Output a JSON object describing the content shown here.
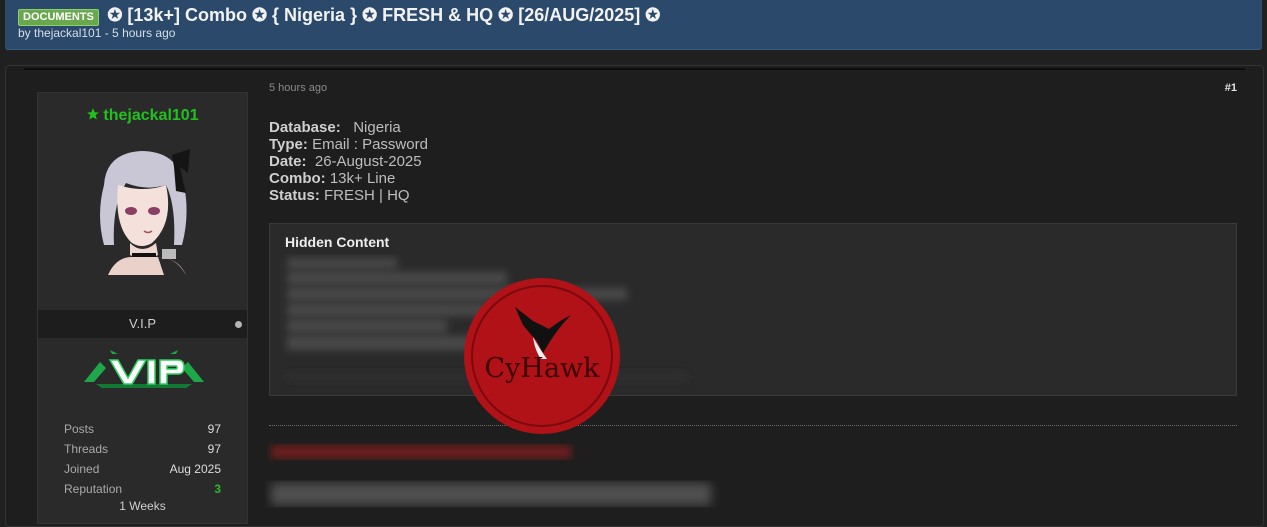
{
  "thread": {
    "prefix": "DOCUMENTS",
    "title": "✪ [13k+] Combo ✪ { Nigeria } ✪ FRESH & HQ ✪ [26/AUG/2025] ✪",
    "meta": "by thejackal101 - 5 hours ago"
  },
  "author": {
    "username": "thejackal101",
    "rank": "V.I.P",
    "badge_icon": "vip-logo",
    "stats": [
      {
        "label": "Posts",
        "value": "97"
      },
      {
        "label": "Threads",
        "value": "97"
      },
      {
        "label": "Joined",
        "value": "Aug 2025"
      },
      {
        "label": "Reputation",
        "value": "3"
      }
    ],
    "activity": "1 Weeks"
  },
  "post": {
    "date": "5 hours ago",
    "number": "#1",
    "fields": [
      {
        "label": "Database:",
        "value": "Nigeria"
      },
      {
        "label": "Type:",
        "value": "Email : Password"
      },
      {
        "label": "Date:",
        "value": "26-August-2025"
      },
      {
        "label": "Combo:",
        "value": "13k+  Line"
      },
      {
        "label": "Status:",
        "value": "FRESH | HQ"
      }
    ],
    "hidden_title": "Hidden Content"
  },
  "watermark": {
    "text": "CyHawk"
  },
  "colors": {
    "header_bg": "#2b4a6b",
    "prefix_green": "#6aa84f",
    "username_green": "#22c01f",
    "reputation_green": "#2fb52f",
    "watermark_red": "#b01217"
  }
}
